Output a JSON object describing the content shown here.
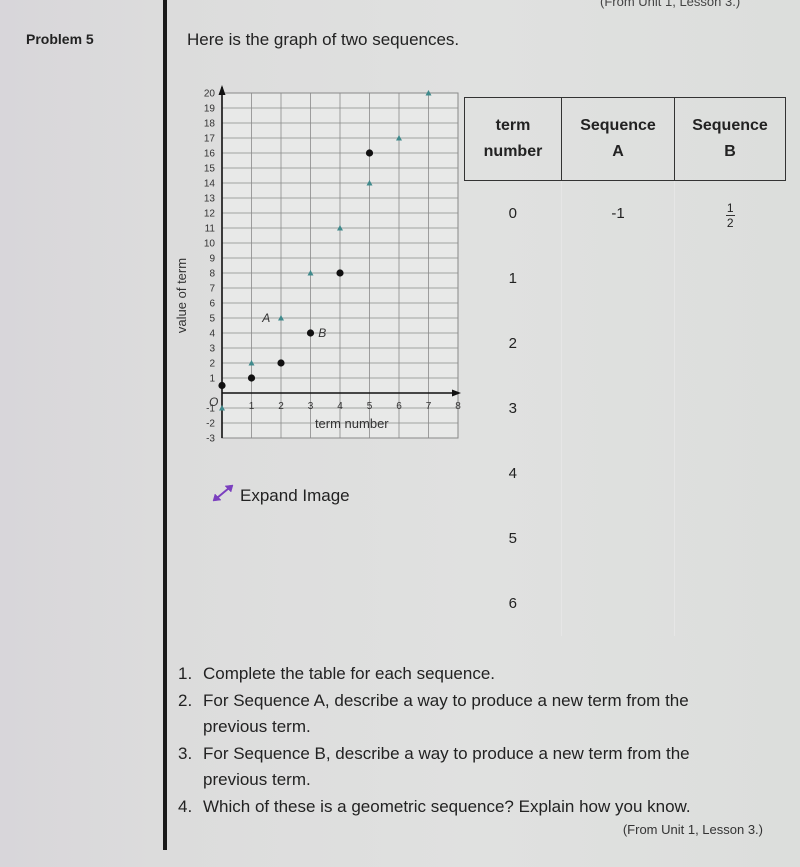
{
  "header": {
    "problem_label": "Problem 5",
    "top_cutoff_text": "(From Unit 1, Lesson 3.)",
    "intro": "Here is the graph of two sequences."
  },
  "expand_image": {
    "label": "Expand Image",
    "icon": "expand-arrows-icon",
    "icon_color": "#7b3fbf"
  },
  "table": {
    "headers": [
      [
        "term",
        "number"
      ],
      [
        "Sequence",
        "A"
      ],
      [
        "Sequence",
        "B"
      ]
    ],
    "rows": [
      {
        "term": "0",
        "a": "-1",
        "b_num": "1",
        "b_den": "2"
      },
      {
        "term": "1",
        "a": "",
        "b_num": "",
        "b_den": ""
      },
      {
        "term": "2",
        "a": "",
        "b_num": "",
        "b_den": ""
      },
      {
        "term": "3",
        "a": "",
        "b_num": "",
        "b_den": ""
      },
      {
        "term": "4",
        "a": "",
        "b_num": "",
        "b_den": ""
      },
      {
        "term": "5",
        "a": "",
        "b_num": "",
        "b_den": ""
      },
      {
        "term": "6",
        "a": "",
        "b_num": "",
        "b_den": ""
      }
    ]
  },
  "questions": [
    {
      "num": "1.",
      "text": "Complete the table for each sequence."
    },
    {
      "num": "2.",
      "text": "For Sequence A, describe a way to produce a new term from the previous term."
    },
    {
      "num": "3.",
      "text": "For Sequence B, describe a way to produce a new term from the previous term."
    },
    {
      "num": "4.",
      "text": "Which of these is a geometric sequence? Explain how you know."
    }
  ],
  "source": "(From Unit 1, Lesson 3.)",
  "chart_data": {
    "type": "scatter",
    "title": "",
    "xlabel": "term number",
    "ylabel": "value of term",
    "xlim": [
      0,
      8
    ],
    "ylim": [
      -3,
      20
    ],
    "xticks": [
      "1",
      "2",
      "3",
      "4",
      "5",
      "6",
      "7",
      "8"
    ],
    "yticks": [
      "-3",
      "-2",
      "-1",
      "1",
      "2",
      "3",
      "4",
      "5",
      "6",
      "7",
      "8",
      "9",
      "10",
      "11",
      "12",
      "13",
      "14",
      "15",
      "16",
      "17",
      "18",
      "19",
      "20"
    ],
    "origin_label": "O",
    "grid": true,
    "series": [
      {
        "name": "A",
        "marker": "triangle",
        "color": "#3f8a8c",
        "x": [
          0,
          1,
          2,
          3,
          4,
          5,
          6,
          7
        ],
        "y": [
          -1,
          2,
          5,
          8,
          11,
          14,
          17,
          20
        ],
        "label_at": [
          1.5,
          5
        ]
      },
      {
        "name": "B",
        "marker": "circle",
        "color": "#111111",
        "x": [
          0,
          1,
          2,
          3,
          4,
          5
        ],
        "y": [
          0.5,
          1,
          2,
          4,
          8,
          16
        ],
        "label_at": [
          3.4,
          4
        ]
      }
    ]
  }
}
